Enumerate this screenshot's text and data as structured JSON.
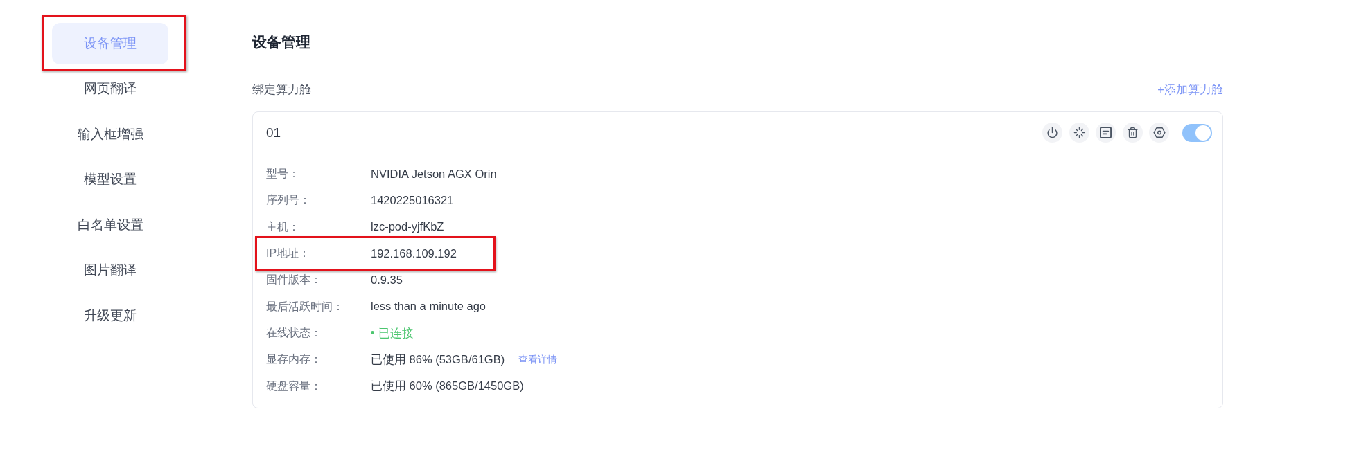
{
  "sidebar": {
    "items": [
      {
        "label": "设备管理",
        "selected": true,
        "highlighted": true
      },
      {
        "label": "网页翻译",
        "selected": false,
        "highlighted": false
      },
      {
        "label": "输入框增强",
        "selected": false,
        "highlighted": false
      },
      {
        "label": "模型设置",
        "selected": false,
        "highlighted": false
      },
      {
        "label": "白名单设置",
        "selected": false,
        "highlighted": false
      },
      {
        "label": "图片翻译",
        "selected": false,
        "highlighted": false
      },
      {
        "label": "升级更新",
        "selected": false,
        "highlighted": false
      }
    ]
  },
  "page": {
    "title": "设备管理"
  },
  "section": {
    "title": "绑定算力舱",
    "add_link": "+添加算力舱"
  },
  "devices": [
    {
      "name": "01",
      "enabled": true,
      "fields": [
        {
          "kind": "text",
          "label": "型号：",
          "value": "NVIDIA Jetson AGX Orin",
          "highlighted": false
        },
        {
          "kind": "text",
          "label": "序列号：",
          "value": "1420225016321",
          "highlighted": false
        },
        {
          "kind": "text",
          "label": "主机：",
          "value": "lzc-pod-yjfKbZ",
          "highlighted": false
        },
        {
          "kind": "text",
          "label": "IP地址：",
          "value": "192.168.109.192",
          "highlighted": true
        },
        {
          "kind": "text",
          "label": "固件版本：",
          "value": "0.9.35",
          "highlighted": false
        },
        {
          "kind": "text",
          "label": "最后活跃时间：",
          "value": "less than a minute ago",
          "highlighted": false
        },
        {
          "kind": "status",
          "label": "在线状态：",
          "value": "已连接",
          "highlighted": false
        },
        {
          "kind": "usage",
          "label": "显存内存：",
          "value": "已使用 86% (53GB/61GB)",
          "link": "查看详情",
          "highlighted": false
        },
        {
          "kind": "text",
          "label": "硬盘容量：",
          "value": "已使用 60% (865GB/1450GB)",
          "highlighted": false
        }
      ]
    }
  ]
}
